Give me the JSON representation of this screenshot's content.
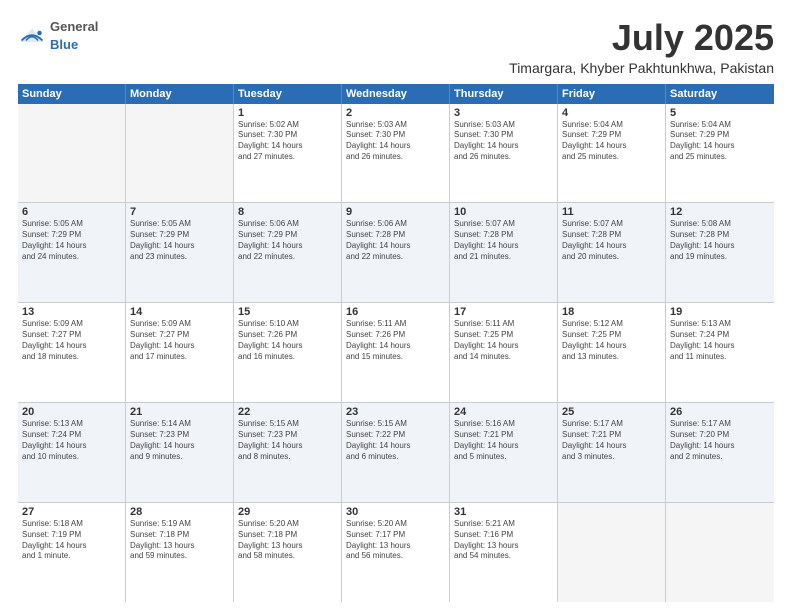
{
  "header": {
    "logo_general": "General",
    "logo_blue": "Blue",
    "title": "July 2025",
    "subtitle": "Timargara, Khyber Pakhtunkhwa, Pakistan"
  },
  "weekdays": [
    "Sunday",
    "Monday",
    "Tuesday",
    "Wednesday",
    "Thursday",
    "Friday",
    "Saturday"
  ],
  "rows": [
    {
      "alt": false,
      "cells": [
        {
          "day": "",
          "text": ""
        },
        {
          "day": "",
          "text": ""
        },
        {
          "day": "1",
          "text": "Sunrise: 5:02 AM\nSunset: 7:30 PM\nDaylight: 14 hours\nand 27 minutes."
        },
        {
          "day": "2",
          "text": "Sunrise: 5:03 AM\nSunset: 7:30 PM\nDaylight: 14 hours\nand 26 minutes."
        },
        {
          "day": "3",
          "text": "Sunrise: 5:03 AM\nSunset: 7:30 PM\nDaylight: 14 hours\nand 26 minutes."
        },
        {
          "day": "4",
          "text": "Sunrise: 5:04 AM\nSunset: 7:29 PM\nDaylight: 14 hours\nand 25 minutes."
        },
        {
          "day": "5",
          "text": "Sunrise: 5:04 AM\nSunset: 7:29 PM\nDaylight: 14 hours\nand 25 minutes."
        }
      ]
    },
    {
      "alt": true,
      "cells": [
        {
          "day": "6",
          "text": "Sunrise: 5:05 AM\nSunset: 7:29 PM\nDaylight: 14 hours\nand 24 minutes."
        },
        {
          "day": "7",
          "text": "Sunrise: 5:05 AM\nSunset: 7:29 PM\nDaylight: 14 hours\nand 23 minutes."
        },
        {
          "day": "8",
          "text": "Sunrise: 5:06 AM\nSunset: 7:29 PM\nDaylight: 14 hours\nand 22 minutes."
        },
        {
          "day": "9",
          "text": "Sunrise: 5:06 AM\nSunset: 7:28 PM\nDaylight: 14 hours\nand 22 minutes."
        },
        {
          "day": "10",
          "text": "Sunrise: 5:07 AM\nSunset: 7:28 PM\nDaylight: 14 hours\nand 21 minutes."
        },
        {
          "day": "11",
          "text": "Sunrise: 5:07 AM\nSunset: 7:28 PM\nDaylight: 14 hours\nand 20 minutes."
        },
        {
          "day": "12",
          "text": "Sunrise: 5:08 AM\nSunset: 7:28 PM\nDaylight: 14 hours\nand 19 minutes."
        }
      ]
    },
    {
      "alt": false,
      "cells": [
        {
          "day": "13",
          "text": "Sunrise: 5:09 AM\nSunset: 7:27 PM\nDaylight: 14 hours\nand 18 minutes."
        },
        {
          "day": "14",
          "text": "Sunrise: 5:09 AM\nSunset: 7:27 PM\nDaylight: 14 hours\nand 17 minutes."
        },
        {
          "day": "15",
          "text": "Sunrise: 5:10 AM\nSunset: 7:26 PM\nDaylight: 14 hours\nand 16 minutes."
        },
        {
          "day": "16",
          "text": "Sunrise: 5:11 AM\nSunset: 7:26 PM\nDaylight: 14 hours\nand 15 minutes."
        },
        {
          "day": "17",
          "text": "Sunrise: 5:11 AM\nSunset: 7:25 PM\nDaylight: 14 hours\nand 14 minutes."
        },
        {
          "day": "18",
          "text": "Sunrise: 5:12 AM\nSunset: 7:25 PM\nDaylight: 14 hours\nand 13 minutes."
        },
        {
          "day": "19",
          "text": "Sunrise: 5:13 AM\nSunset: 7:24 PM\nDaylight: 14 hours\nand 11 minutes."
        }
      ]
    },
    {
      "alt": true,
      "cells": [
        {
          "day": "20",
          "text": "Sunrise: 5:13 AM\nSunset: 7:24 PM\nDaylight: 14 hours\nand 10 minutes."
        },
        {
          "day": "21",
          "text": "Sunrise: 5:14 AM\nSunset: 7:23 PM\nDaylight: 14 hours\nand 9 minutes."
        },
        {
          "day": "22",
          "text": "Sunrise: 5:15 AM\nSunset: 7:23 PM\nDaylight: 14 hours\nand 8 minutes."
        },
        {
          "day": "23",
          "text": "Sunrise: 5:15 AM\nSunset: 7:22 PM\nDaylight: 14 hours\nand 6 minutes."
        },
        {
          "day": "24",
          "text": "Sunrise: 5:16 AM\nSunset: 7:21 PM\nDaylight: 14 hours\nand 5 minutes."
        },
        {
          "day": "25",
          "text": "Sunrise: 5:17 AM\nSunset: 7:21 PM\nDaylight: 14 hours\nand 3 minutes."
        },
        {
          "day": "26",
          "text": "Sunrise: 5:17 AM\nSunset: 7:20 PM\nDaylight: 14 hours\nand 2 minutes."
        }
      ]
    },
    {
      "alt": false,
      "cells": [
        {
          "day": "27",
          "text": "Sunrise: 5:18 AM\nSunset: 7:19 PM\nDaylight: 14 hours\nand 1 minute."
        },
        {
          "day": "28",
          "text": "Sunrise: 5:19 AM\nSunset: 7:18 PM\nDaylight: 13 hours\nand 59 minutes."
        },
        {
          "day": "29",
          "text": "Sunrise: 5:20 AM\nSunset: 7:18 PM\nDaylight: 13 hours\nand 58 minutes."
        },
        {
          "day": "30",
          "text": "Sunrise: 5:20 AM\nSunset: 7:17 PM\nDaylight: 13 hours\nand 56 minutes."
        },
        {
          "day": "31",
          "text": "Sunrise: 5:21 AM\nSunset: 7:16 PM\nDaylight: 13 hours\nand 54 minutes."
        },
        {
          "day": "",
          "text": ""
        },
        {
          "day": "",
          "text": ""
        }
      ]
    }
  ]
}
